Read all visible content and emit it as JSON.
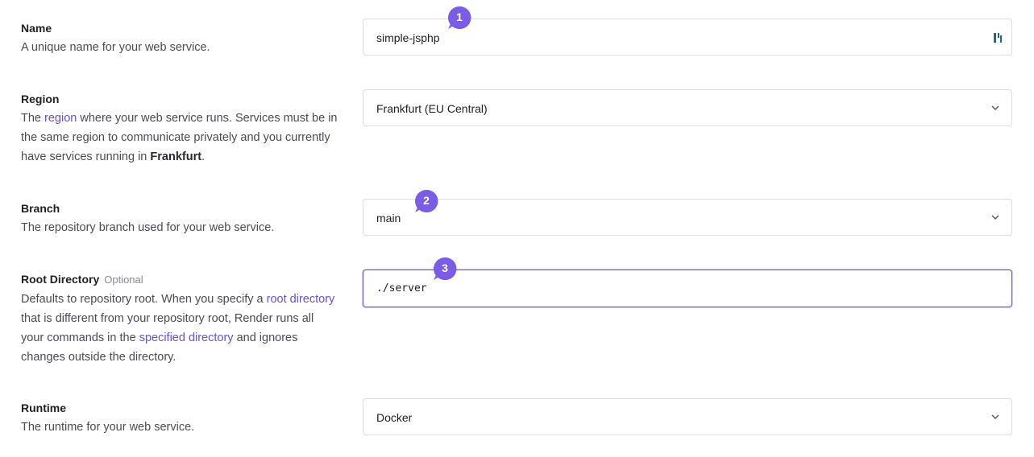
{
  "fields": {
    "name": {
      "title": "Name",
      "desc": "A unique name for your web service.",
      "value": "simple-jsphp",
      "step": "1"
    },
    "region": {
      "title": "Region",
      "desc_pre": "The ",
      "desc_link": "region",
      "desc_mid": " where your web service runs. Services must be in the same region to communicate privately and you currently have services running in ",
      "desc_bold": "Frankfurt",
      "desc_end": ".",
      "value": "Frankfurt (EU Central)"
    },
    "branch": {
      "title": "Branch",
      "desc": "The repository branch used for your web service.",
      "value": "main",
      "step": "2"
    },
    "root_directory": {
      "title": "Root Directory",
      "optional": "Optional",
      "desc_pre": "Defaults to repository root. When you specify a ",
      "desc_link1": "root directory",
      "desc_mid": " that is different from your repository root, Render runs all your commands in the ",
      "desc_link2": "specified directory",
      "desc_end": " and ignores changes outside the directory.",
      "value": "./server",
      "step": "3"
    },
    "runtime": {
      "title": "Runtime",
      "desc": "The runtime for your web service.",
      "value": "Docker"
    }
  },
  "colors": {
    "accent": "#6a4fd8",
    "bubble": "#7b5ce6",
    "border": "#dcdce2"
  },
  "icons": {
    "select": "chevron-down-icon",
    "password_manager": "password-manager-icon",
    "step_marker": "speech-bubble-icon"
  }
}
